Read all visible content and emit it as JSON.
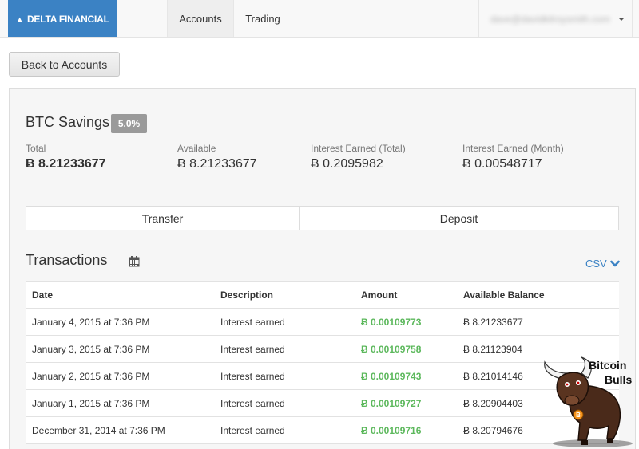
{
  "navbar": {
    "brand": "DELTA FINANCIAL",
    "tabs": [
      {
        "label": "Accounts",
        "active": true
      },
      {
        "label": "Trading",
        "active": false
      }
    ],
    "user_email": "dave@davidkilroysmith.com"
  },
  "back_button": "Back to Accounts",
  "account": {
    "title": "BTC Savings",
    "rate": "5.0%",
    "stats": [
      {
        "label": "Total",
        "value": "Ƀ 8.21233677"
      },
      {
        "label": "Available",
        "value": "Ƀ 8.21233677"
      },
      {
        "label": "Interest Earned (Total)",
        "value": "Ƀ 0.2095982"
      },
      {
        "label": "Interest Earned (Month)",
        "value": "Ƀ 0.00548717"
      }
    ]
  },
  "actions": {
    "transfer": "Transfer",
    "deposit": "Deposit"
  },
  "transactions": {
    "title": "Transactions",
    "csv_label": "CSV",
    "columns": [
      "Date",
      "Description",
      "Amount",
      "Available Balance"
    ],
    "rows": [
      {
        "date": "January 4, 2015 at 7:36 PM",
        "description": "Interest earned",
        "amount": "Ƀ 0.00109773",
        "balance": "Ƀ 8.21233677"
      },
      {
        "date": "January 3, 2015 at 7:36 PM",
        "description": "Interest earned",
        "amount": "Ƀ 0.00109758",
        "balance": "Ƀ 8.21123904"
      },
      {
        "date": "January 2, 2015 at 7:36 PM",
        "description": "Interest earned",
        "amount": "Ƀ 0.00109743",
        "balance": "Ƀ 8.21014146"
      },
      {
        "date": "January 1, 2015 at 7:36 PM",
        "description": "Interest earned",
        "amount": "Ƀ 0.00109727",
        "balance": "Ƀ 8.20904403"
      },
      {
        "date": "December 31, 2014 at 7:36 PM",
        "description": "Interest earned",
        "amount": "Ƀ 0.00109716",
        "balance": "Ƀ 8.20794676"
      }
    ]
  },
  "logo": {
    "line1": "Bitcoin",
    "line2": "Bulls"
  },
  "colors": {
    "brand": "#3b82c4",
    "amount_positive": "#5cb85c",
    "badge": "#9a9a9a"
  }
}
